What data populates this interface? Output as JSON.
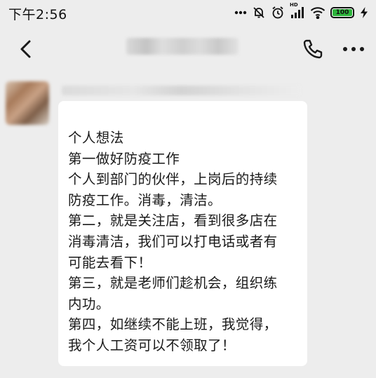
{
  "status_bar": {
    "time": "下午2:56",
    "icons": [
      "more-dots-icon",
      "mute-icon",
      "alarm-icon",
      "signal-icon",
      "wifi-icon",
      "battery-icon",
      "charging-icon"
    ],
    "signal_tag": "HD",
    "battery_level": "100",
    "battery_fraction": 1.0,
    "battery_color": "#2db53c"
  },
  "nav_bar": {
    "back_icon": "chevron-left-icon",
    "call_icon": "phone-icon",
    "more_icon": "more-horizontal-icon"
  },
  "message": {
    "bubble_color": "#ffffff",
    "lines": [
      "个人想法",
      "第一做好防疫工作",
      "个人到部门的伙伴，上岗后的持续",
      "防疫工作。消毒，清洁。",
      "第二，就是关注店，看到很多店在",
      "消毒清洁，我们可以打电话或者有",
      "可能去看下！",
      "第三，就是老师们趁机会，组织练",
      "内功。",
      "第四，如继续不能上班，我觉得，",
      "我个人工资可以不领取了！"
    ]
  }
}
